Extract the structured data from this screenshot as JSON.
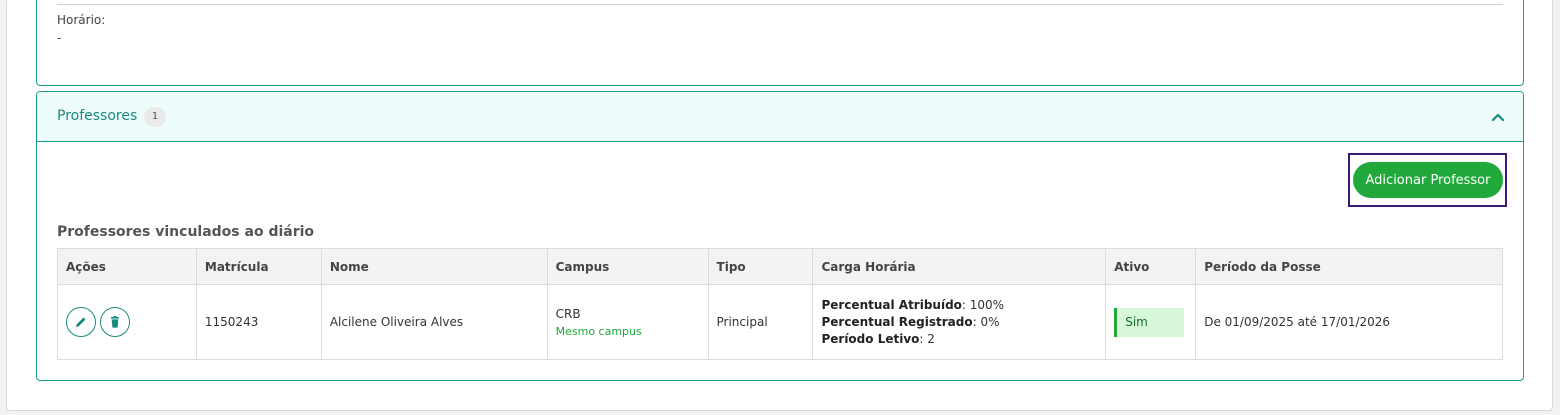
{
  "horario": {
    "label": "Horário:",
    "value": "-"
  },
  "professores": {
    "title": "Professores",
    "count": "1",
    "add_button": "Adicionar Professor",
    "section_title": "Professores vinculados ao diário",
    "columns": [
      "Ações",
      "Matrícula",
      "Nome",
      "Campus",
      "Tipo",
      "Carga Horária",
      "Ativo",
      "Período da Posse"
    ],
    "rows": [
      {
        "matricula": "1150243",
        "nome": "Alcilene Oliveira Alves",
        "campus": "CRB",
        "campus_note": "Mesmo campus",
        "tipo": "Principal",
        "carga": [
          {
            "label": "Percentual Atribuído",
            "value": ": 100%"
          },
          {
            "label": "Percentual Registrado",
            "value": ": 0%"
          },
          {
            "label": "Período Letivo",
            "value": ": 2"
          }
        ],
        "ativo": "Sim",
        "periodo": "De 01/09/2025 até 17/01/2026"
      }
    ]
  },
  "colors": {
    "accent": "#1a8a7c",
    "button": "#21a83a",
    "focus_border": "#3b1a7a"
  },
  "icons": [
    "chevron-up-icon",
    "pencil-icon",
    "trash-icon"
  ]
}
